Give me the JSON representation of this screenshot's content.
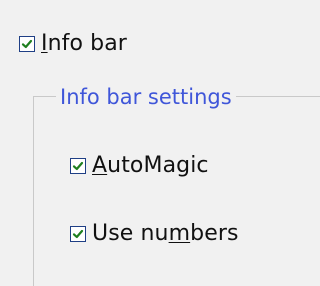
{
  "info_bar": {
    "label_prefix": "",
    "label_mnemonic": "I",
    "label_suffix": "nfo bar",
    "checked": true
  },
  "group": {
    "title": "Info bar settings"
  },
  "options": {
    "automagic": {
      "label_prefix": "",
      "label_mnemonic": "A",
      "label_suffix": "utoMagic",
      "checked": true
    },
    "use_numbers": {
      "label_prefix": "Use nu",
      "label_mnemonic": "m",
      "label_suffix": "bers",
      "checked": true
    }
  },
  "icons": {
    "check_icon": "check-icon"
  },
  "colors": {
    "background": "#f1f1f1",
    "checkbox_border": "#1f3f85",
    "checkmark": "#1f7f1f",
    "group_title": "#3f56d9",
    "group_border": "#c9c9c9"
  }
}
